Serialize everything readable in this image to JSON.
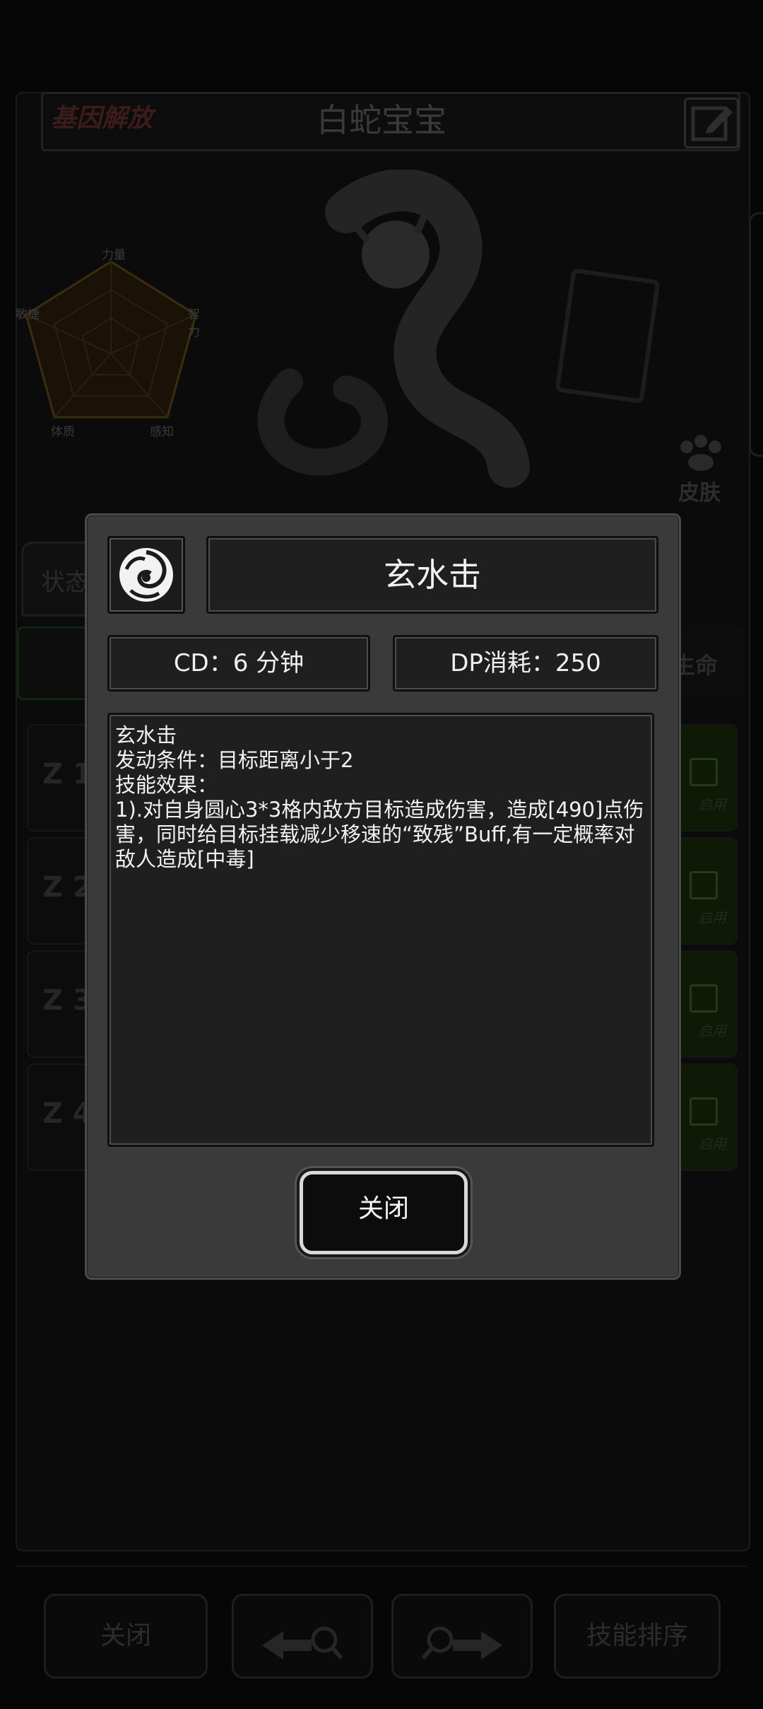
{
  "background": {
    "gene_logo": "基因解放",
    "pet_name": "白蛇宝宝",
    "radar_labels": {
      "strength": "力量",
      "intellect": "智力",
      "perception": "感知",
      "physique": "体质",
      "agility": "敏捷"
    },
    "skin_label": "皮肤",
    "status_tab": "状态",
    "life_filter": "生命",
    "skill_rows": [
      {
        "key": "Z 1",
        "enable": "启用"
      },
      {
        "key": "Z 2",
        "enable": "启用"
      },
      {
        "key": "Z 3",
        "enable": "启用"
      },
      {
        "key": "Z 4",
        "enable": "启用"
      }
    ],
    "bottom_buttons": {
      "close": "关闭",
      "skill_sort": "技能排序"
    }
  },
  "dialog": {
    "skill_icon": "skill-icon-swirl",
    "skill_name": "玄水击",
    "cd": "CD：6 分钟",
    "dp_cost": "DP消耗：250",
    "description": {
      "line1": "玄水击",
      "line2": "发动条件：目标距离小于2",
      "line3": "技能效果：",
      "line4": "1).对自身圆心3*3格内敌方目标造成伤害，造成[490]点伤害，同时给目标挂载减少移速的“致残”Buff,有一定概率对敌人造成[中毒]"
    },
    "close_label": "关闭"
  },
  "colors": {
    "dialog_bg": "#3a3a3a",
    "field_bg": "#1f1f1f",
    "text": "#f2f2f2"
  }
}
